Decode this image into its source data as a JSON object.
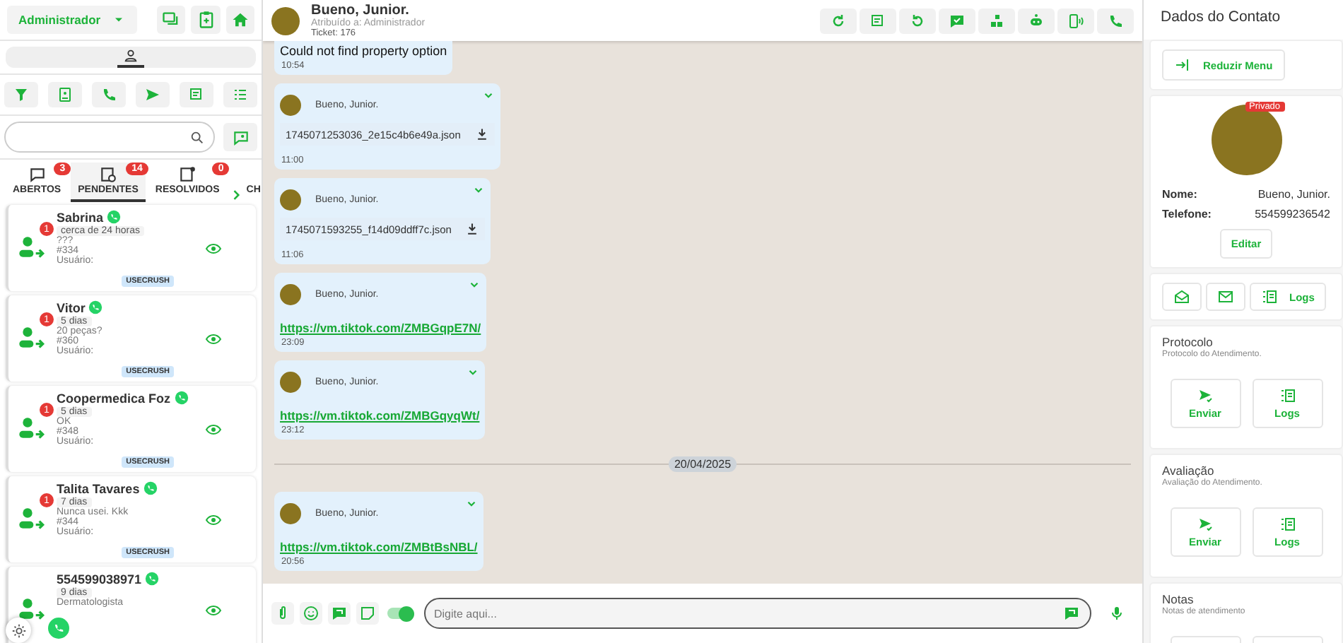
{
  "sidebar": {
    "user_menu": "Administrador",
    "tabs": [
      {
        "label": "ABERTOS",
        "count": "3",
        "selected": false
      },
      {
        "label": "PENDENTES",
        "count": "14",
        "selected": true
      },
      {
        "label": "RESOLVIDOS",
        "count": "0",
        "selected": false
      },
      {
        "label": "CH",
        "selected": false
      }
    ],
    "contacts": [
      {
        "name": "Sabrina",
        "time": "cerca de 24 horas",
        "message": "???",
        "ticket": "#334",
        "user_label": "Usuário:",
        "tag": "USECRUSH",
        "unread": "1"
      },
      {
        "name": "Vitor",
        "time": "5 dias",
        "message": "20 peças?",
        "ticket": "#360",
        "user_label": "Usuário:",
        "tag": "USECRUSH",
        "unread": "1"
      },
      {
        "name": "Coopermedica Foz",
        "time": "5 dias",
        "message": "OK",
        "ticket": "#348",
        "user_label": "Usuário:",
        "tag": "USECRUSH",
        "unread": "1"
      },
      {
        "name": "Talita Tavares",
        "time": "7 dias",
        "message": "Nunca usei. Kkk",
        "ticket": "#344",
        "user_label": "Usuário:",
        "tag": "USECRUSH",
        "unread": "1"
      },
      {
        "name": "554599038971",
        "time": "9 dias",
        "message": "Dermatologista"
      }
    ]
  },
  "chat": {
    "header": {
      "name": "Bueno, Junior.",
      "assigned": "Atribuído a: Administrador",
      "ticket": "Ticket: 176"
    },
    "messages": [
      {
        "kind": "text",
        "text": "Could not find property option",
        "time": "10:54"
      },
      {
        "kind": "file",
        "sender": "Bueno, Junior.",
        "file": "1745071253036_2e15c4b6e49a.json",
        "time": "11:00"
      },
      {
        "kind": "file",
        "sender": "Bueno, Junior.",
        "file": "1745071593255_f14d09ddff7c.json",
        "time": "11:06"
      },
      {
        "kind": "link",
        "sender": "Bueno, Junior.",
        "link": "https://vm.tiktok.com/ZMBGqpE7N/",
        "time": "23:09"
      },
      {
        "kind": "link",
        "sender": "Bueno, Junior.",
        "link": "https://vm.tiktok.com/ZMBGqyqWt/",
        "time": "23:12"
      },
      {
        "kind": "date",
        "text": "20/04/2025"
      },
      {
        "kind": "link",
        "sender": "Bueno, Junior.",
        "link": "https://vm.tiktok.com/ZMBtBsNBL/",
        "time": "20:56"
      }
    ],
    "composer": {
      "signature_on": true,
      "placeholder": "Digite aqui..."
    }
  },
  "contact_panel": {
    "title": "Dados do Contato",
    "collapse_button": "Reduzir Menu",
    "badge": "Privado",
    "fields": [
      {
        "label": "Nome:",
        "value": "Bueno, Junior."
      },
      {
        "label": "Telefone:",
        "value": "554599236542"
      }
    ],
    "edit_button": "Editar",
    "logs_button": "Logs",
    "sections": [
      {
        "title": "Protocolo",
        "subtitle": "Protocolo do Atendimento.",
        "buttons": [
          "Enviar",
          "Logs"
        ]
      },
      {
        "title": "Avaliação",
        "subtitle": "Avaliação do Atendimento.",
        "buttons": [
          "Enviar",
          "Logs"
        ]
      },
      {
        "title": "Notas",
        "subtitle": "Notas de atendimento"
      }
    ]
  }
}
